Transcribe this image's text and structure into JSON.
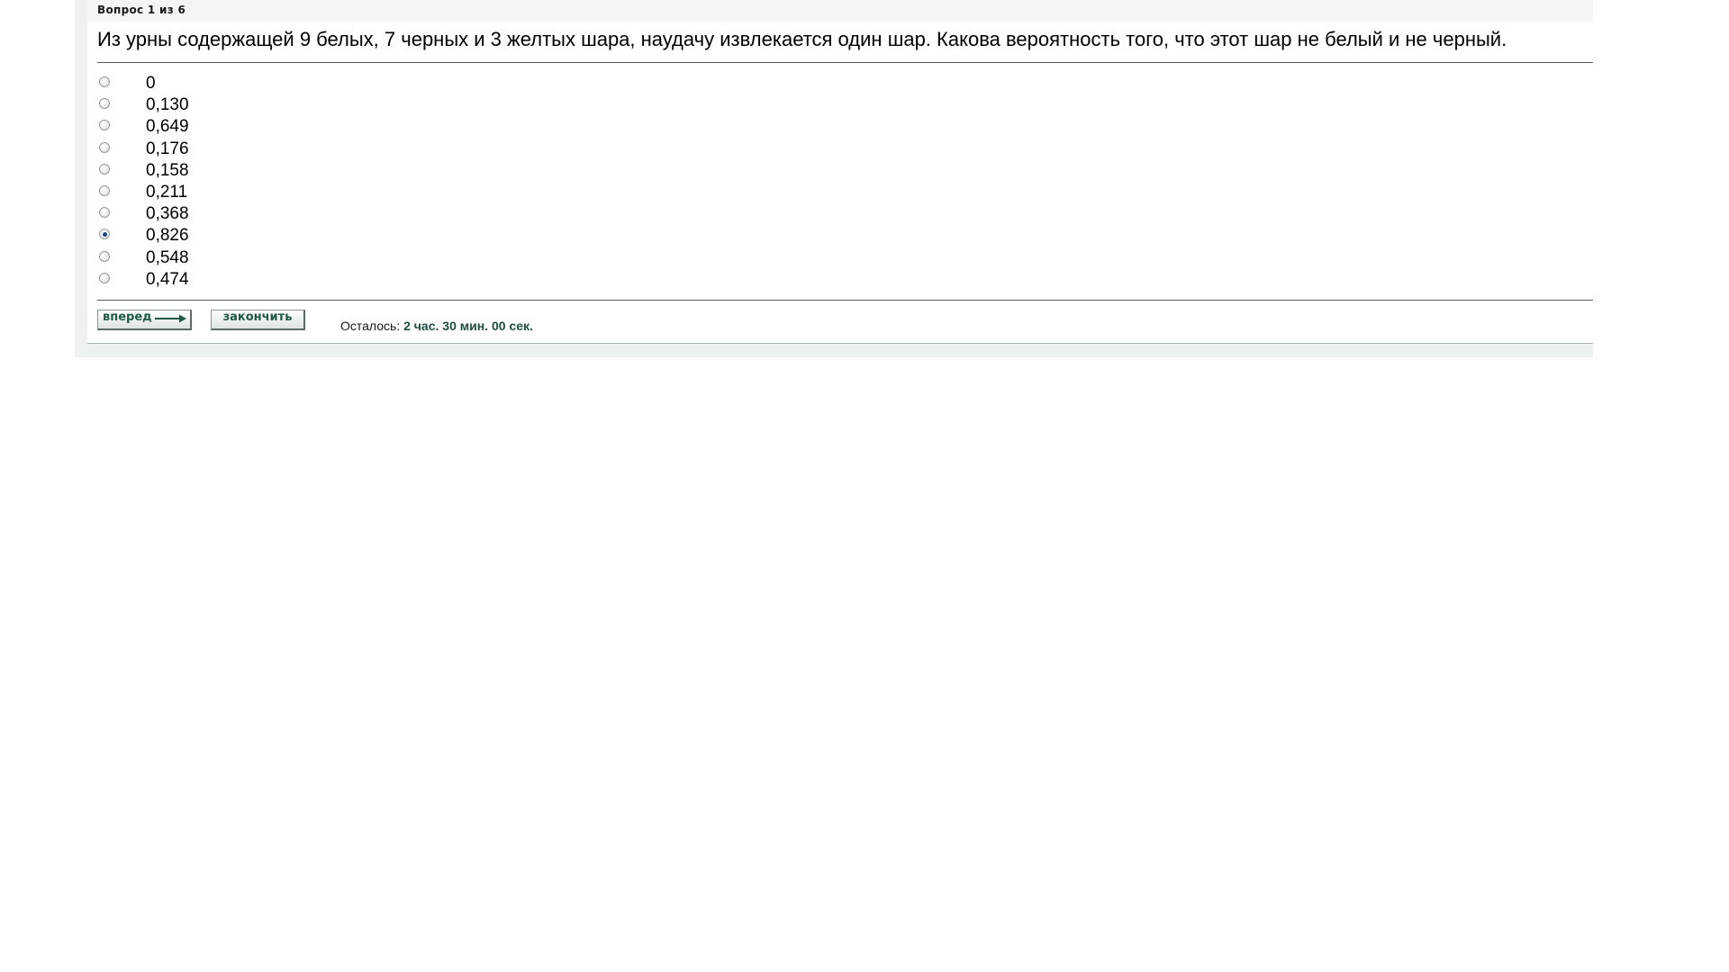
{
  "question": {
    "counter": "Вопрос 1 из 6",
    "text": "Из урны содержащей 9 белых, 7 черных и 3 желтых шара, наудачу извлекается один шар. Какова вероятность того, что этот шар не белый и не черный."
  },
  "options": [
    {
      "label": "0",
      "selected": false
    },
    {
      "label": "0,130",
      "selected": false
    },
    {
      "label": "0,649",
      "selected": false
    },
    {
      "label": "0,176",
      "selected": false
    },
    {
      "label": "0,158",
      "selected": false
    },
    {
      "label": "0,211",
      "selected": false
    },
    {
      "label": "0,368",
      "selected": false
    },
    {
      "label": "0,826",
      "selected": true
    },
    {
      "label": "0,548",
      "selected": false
    },
    {
      "label": "0,474",
      "selected": false
    }
  ],
  "buttons": {
    "next_label": "вперед",
    "next_icon": "arrow-right-icon",
    "finish_label": "закончить"
  },
  "timer": {
    "label": "Осталось:",
    "value": "2 час. 30 мин. 00 сек."
  },
  "colors": {
    "button_text": "#1f5a45",
    "timer_value": "#1d4f40",
    "radio_selected": "#1f4a75",
    "panel_background": "#edf1ef"
  }
}
